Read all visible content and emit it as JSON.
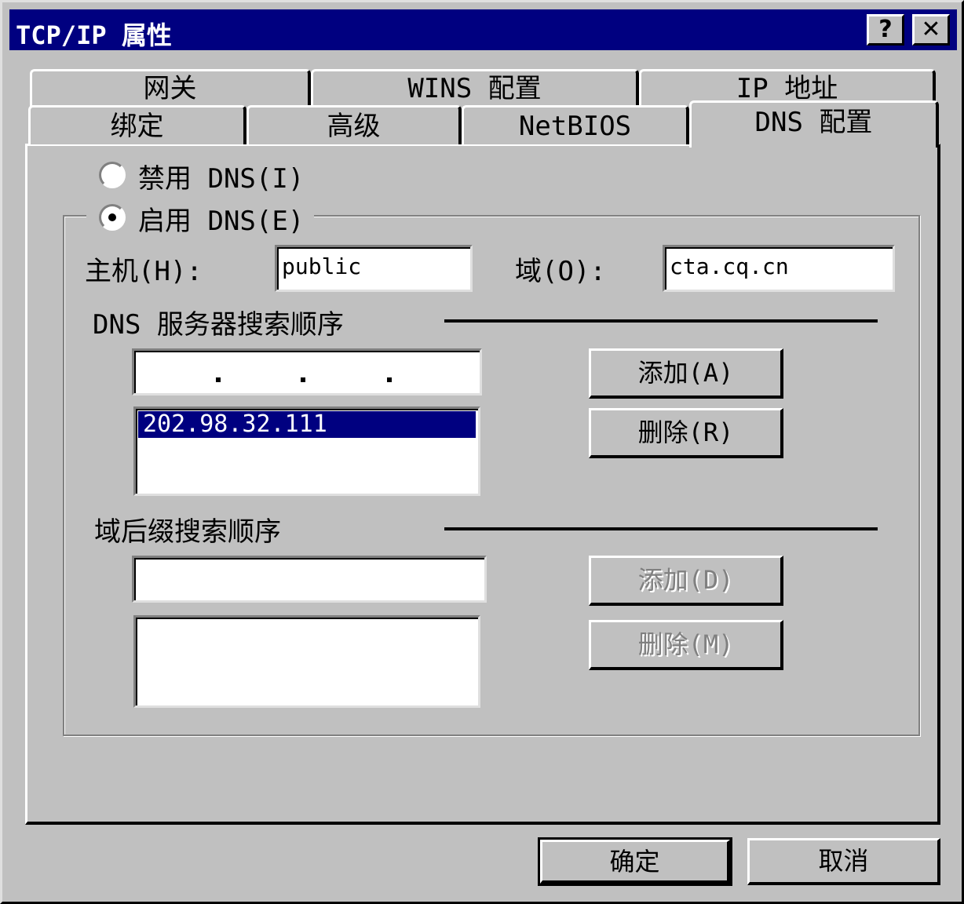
{
  "window": {
    "title": "TCP/IP 属性",
    "help_glyph": "?",
    "close_glyph": "✕"
  },
  "tabs": {
    "row_back": [
      {
        "label": "网关"
      },
      {
        "label": "WINS 配置"
      },
      {
        "label": "IP 地址"
      }
    ],
    "row_front": [
      {
        "label": "绑定"
      },
      {
        "label": "高级"
      },
      {
        "label": "NetBIOS"
      },
      {
        "label": "DNS 配置",
        "active": true
      }
    ]
  },
  "dns": {
    "disable_label": "禁用 DNS(I)",
    "enable_label": "启用 DNS(E)",
    "selected": "enable",
    "host_label": "主机(H):",
    "host_value": "public",
    "domain_label": "域(O):",
    "domain_value": "cta.cq.cn",
    "server_order_label": "DNS 服务器搜索顺序",
    "server_list": [
      "202.98.32.111"
    ],
    "add_label": "添加(A)",
    "remove_label": "删除(R)",
    "suffix_order_label": "域后缀搜索顺序",
    "suffix_add_label": "添加(D)",
    "suffix_remove_label": "删除(M)"
  },
  "footer": {
    "ok_label": "确定",
    "cancel_label": "取消"
  }
}
